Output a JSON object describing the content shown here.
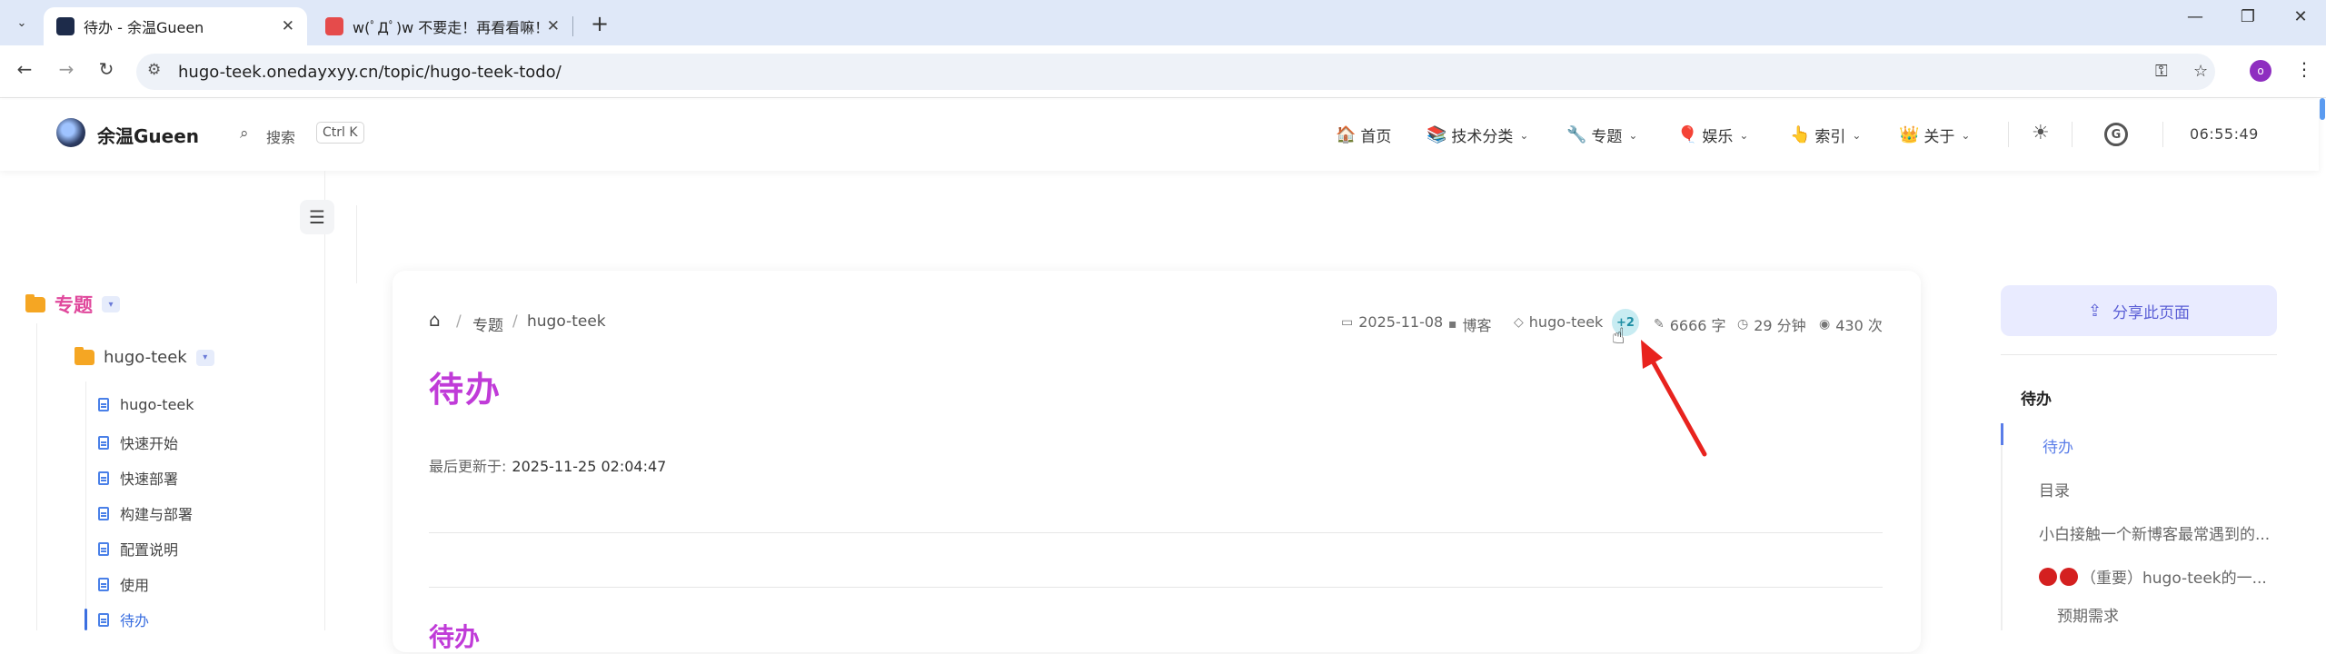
{
  "browser": {
    "tabs": [
      {
        "title": "待办 - 余温Gueen",
        "close": "✕"
      },
      {
        "title": "w(ﾟДﾟ)w 不要走！再看看嘛！",
        "close": "✕"
      }
    ],
    "new_tab": "+",
    "tab_search": "⌄",
    "window_controls": {
      "minimize": "—",
      "restore": "❐",
      "close": "✕"
    },
    "nav": {
      "back": "←",
      "forward": "→",
      "reload": "↻"
    },
    "url": "hugo-teek.onedayxyy.cn/topic/hugo-teek-todo/",
    "profile_initial": "o",
    "icons": [
      "site-info-icon",
      "key-icon",
      "star-icon",
      "menu-icon"
    ]
  },
  "site": {
    "name": "余温Gueen",
    "search_label": "搜索",
    "search_shortcut": "Ctrl K",
    "nav": [
      {
        "label": "首页",
        "icon": "🏠",
        "has_menu": false
      },
      {
        "label": "技术分类",
        "icon": "📚",
        "has_menu": true
      },
      {
        "label": "专题",
        "icon": "🔧",
        "has_menu": true
      },
      {
        "label": "娱乐",
        "icon": "🎈",
        "has_menu": true
      },
      {
        "label": "索引",
        "icon": "👆",
        "has_menu": true
      },
      {
        "label": "关于",
        "icon": "👑",
        "has_menu": true
      }
    ],
    "theme_icon": "☀",
    "github_icon": "G",
    "clock": "06:55:49"
  },
  "sidebar": {
    "toggle_icon": "☰",
    "root_folder": "专题",
    "sub_folder": "hugo-teek",
    "expand_icon": "▾",
    "docs": [
      "hugo-teek",
      "快速开始",
      "快速部署",
      "构建与部署",
      "配置说明",
      "使用",
      "待办"
    ],
    "active_doc_index": 6
  },
  "article": {
    "breadcrumb": [
      "专题",
      "hugo-teek"
    ],
    "breadcrumb_sep": "/",
    "meta": {
      "date": "2025-11-08",
      "category": "博客",
      "tag": "hugo-teek",
      "more_tags": "+2",
      "words": "6666 字",
      "read_time": "29 分钟",
      "views": "430 次"
    },
    "title": "待办",
    "updated_label": "最后更新于:",
    "updated_value": "2025-11-25 02:04:47",
    "next_heading_peek": "待办"
  },
  "right": {
    "share_label": "分享此页面",
    "toc_title": "待办",
    "toc": [
      {
        "label": "待办",
        "active": true
      },
      {
        "label": "目录",
        "active": false
      },
      {
        "label": "小白接触一个新博客最常遇到的...",
        "active": false
      },
      {
        "label": "（重要）hugo-teek的一...",
        "active": false,
        "dots": 2
      },
      {
        "label": "预期需求",
        "active": false
      }
    ]
  },
  "colors": {
    "title": "#c03bd8",
    "accent": "#5a7de8",
    "folder": "#f5a623",
    "root_folder_text": "#e0489c",
    "annotation": "#e8231e"
  }
}
